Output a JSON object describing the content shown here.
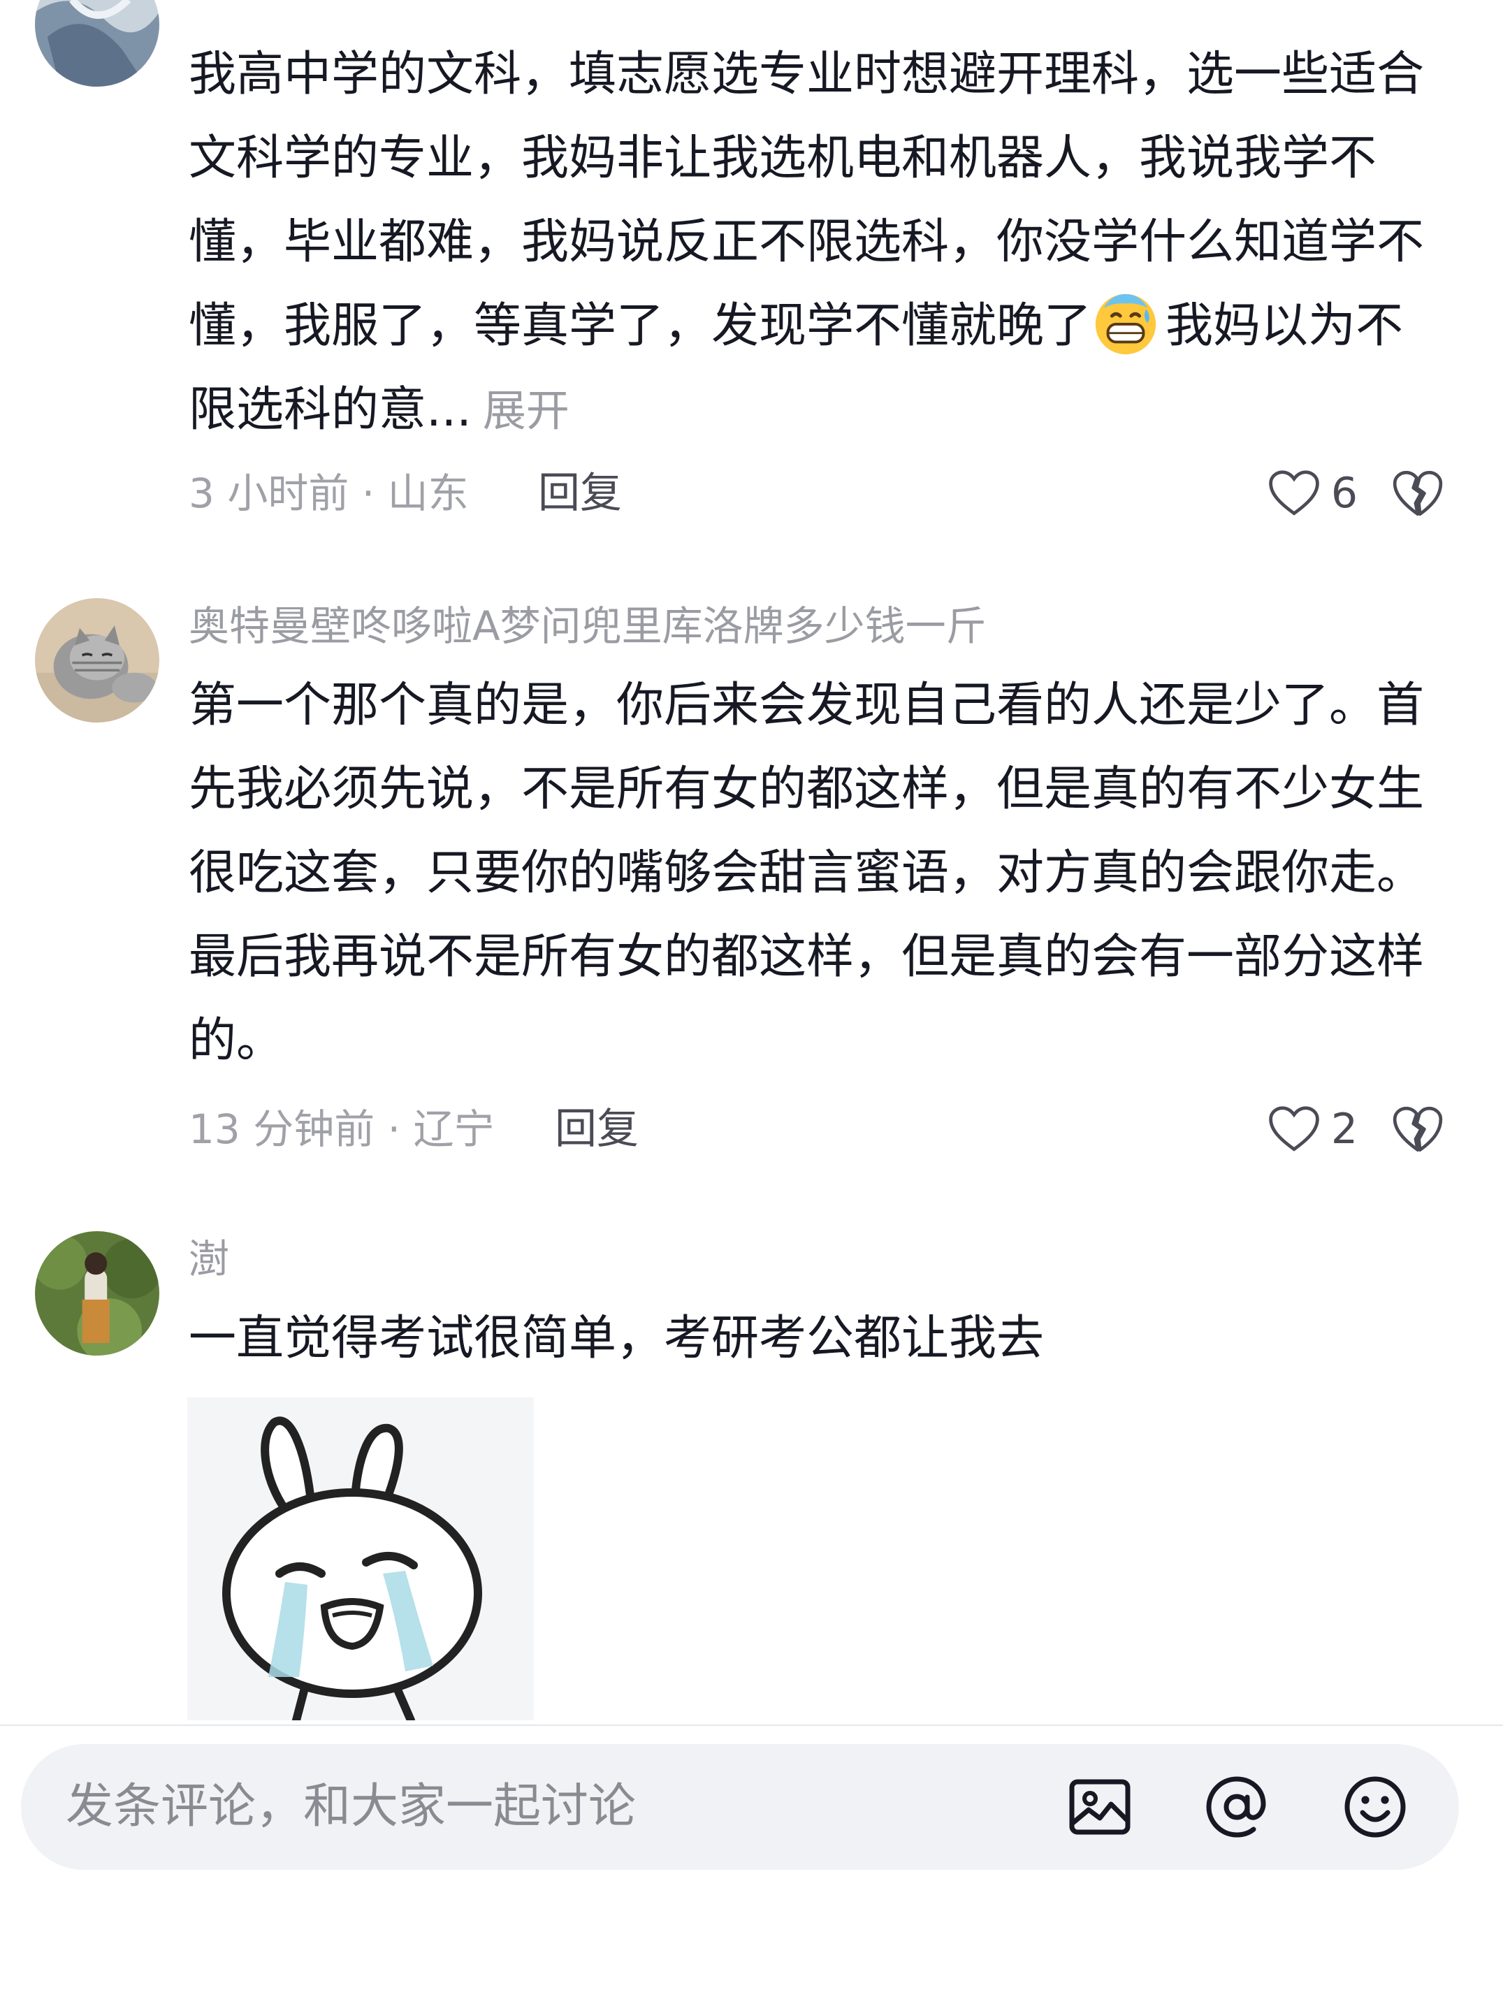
{
  "comments": [
    {
      "username": "",
      "text": "我高中学的文科，填志愿选专业时想避开理科，选一些适合文科学的专业，我妈非让我选机电和机器人，我说我学不懂，毕业都难，我妈说反正不限选科，你没学什么知道学不懂，我服了，等真学了，发现学不懂就晚了",
      "text_after_emoji": "我妈以为不限选科的意...",
      "emoji": "grinning-sweat-emoji",
      "expand_label": "展开",
      "time_location": "3 小时前 · 山东",
      "reply_label": "回复",
      "like_count": "6"
    },
    {
      "username": "奥特曼壁咚哆啦A梦问兜里库洛牌多少钱一斤",
      "text": "第一个那个真的是，你后来会发现自己看的人还是少了。首先我必须先说，不是所有女的都这样，但是真的有不少女生很吃这套，只要你的嘴够会甜言蜜语，对方真的会跟你走。最后我再说不是所有女的都这样，但是真的会有一部分这样的。",
      "time_location": "13 分钟前 · 辽宁",
      "reply_label": "回复",
      "like_count": "2"
    },
    {
      "username": "澍",
      "text": "一直觉得考试很简单，考研考公都让我去",
      "sticker": "crying-bunny-sticker"
    }
  ],
  "input_bar": {
    "placeholder": "发条评论，和大家一起讨论",
    "icons": [
      "image-icon",
      "at-icon",
      "emoji-icon"
    ]
  },
  "colors": {
    "text_primary": "#161823",
    "text_secondary": "#9b9ca3",
    "input_bg": "#f1f2f5"
  }
}
